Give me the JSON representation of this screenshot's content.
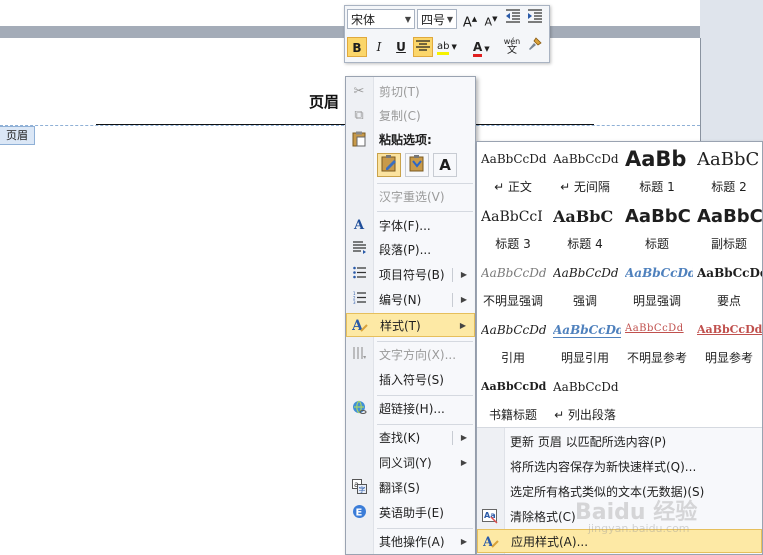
{
  "document": {
    "header_title": "页眉",
    "header_tag": "页眉"
  },
  "mini_toolbar": {
    "font_name": "宋体",
    "font_size": "四号",
    "grow_font": "A",
    "shrink_font": "A",
    "bold": "B",
    "italic": "I",
    "underline": "U",
    "highlight": "ab",
    "font_color": "A",
    "phonetic": "wén"
  },
  "context_menu": {
    "items": [
      {
        "label": "剪切(T)",
        "icon": "scissors-icon",
        "disabled": true
      },
      {
        "label": "复制(C)",
        "icon": "copy-icon",
        "disabled": true
      },
      {
        "label": "粘贴选项:",
        "icon": "clipboard-icon"
      },
      {
        "label": "汉字重选(V)",
        "disabled": true
      },
      {
        "label": "字体(F)...",
        "icon": "font-icon"
      },
      {
        "label": "段落(P)...",
        "icon": "paragraph-icon"
      },
      {
        "label": "项目符号(B)",
        "icon": "bullets-icon"
      },
      {
        "label": "编号(N)",
        "icon": "numbering-icon"
      },
      {
        "label": "样式(T)",
        "icon": "styles-icon"
      },
      {
        "label": "文字方向(X)...",
        "icon": "text-direction-icon",
        "disabled": true
      },
      {
        "label": "插入符号(S)"
      },
      {
        "label": "超链接(H)...",
        "icon": "hyperlink-icon"
      },
      {
        "label": "查找(K)"
      },
      {
        "label": "同义词(Y)"
      },
      {
        "label": "翻译(S)",
        "icon": "translate-icon"
      },
      {
        "label": "英语助手(E)",
        "icon": "english-assistant-icon"
      },
      {
        "label": "其他操作(A)"
      }
    ],
    "paste_buttons": [
      "keep-source-format-icon",
      "merge-format-icon",
      "text-only-icon"
    ],
    "paste_text_only": "A"
  },
  "styles_gallery": {
    "styles": [
      {
        "preview": "AaBbCcDd",
        "name": "↵ 正文"
      },
      {
        "preview": "AaBbCcDd",
        "name": "↵ 无间隔"
      },
      {
        "preview": "AaBb",
        "name": "标题 1"
      },
      {
        "preview": "AaBbC",
        "name": "标题 2"
      },
      {
        "preview": "AaBbCcI",
        "name": "标题 3"
      },
      {
        "preview": "AaBbC",
        "name": "标题 4"
      },
      {
        "preview": "AaBbC",
        "name": "标题"
      },
      {
        "preview": "AaBbC",
        "name": "副标题"
      },
      {
        "preview": "AaBbCcDd",
        "name": "不明显强调"
      },
      {
        "preview": "AaBbCcDd",
        "name": "强调"
      },
      {
        "preview": "AaBbCcDd",
        "name": "明显强调"
      },
      {
        "preview": "AaBbCcDd",
        "name": "要点"
      },
      {
        "preview": "AaBbCcDd",
        "name": "引用"
      },
      {
        "preview": "AaBbCcDd",
        "name": "明显引用"
      },
      {
        "preview": "AaBbCcDd",
        "name": "不明显参考"
      },
      {
        "preview": "AaBbCcDd",
        "name": "明显参考"
      },
      {
        "preview": "AaBbCcDd",
        "name": "书籍标题"
      },
      {
        "preview": "AaBbCcDd",
        "name": "↵ 列出段落"
      }
    ],
    "commands": [
      {
        "label": "更新 页眉 以匹配所选内容(P)"
      },
      {
        "label": "将所选内容保存为新快速样式(Q)..."
      },
      {
        "label": "选定所有格式类似的文本(无数据)(S)"
      },
      {
        "label": "清除格式(C)",
        "icon": "clear-format-icon"
      },
      {
        "label": "应用样式(A)...",
        "icon": "apply-styles-icon"
      }
    ]
  },
  "watermark": {
    "main": "Baidu 经验",
    "sub": "jingyan.baidu.com"
  }
}
